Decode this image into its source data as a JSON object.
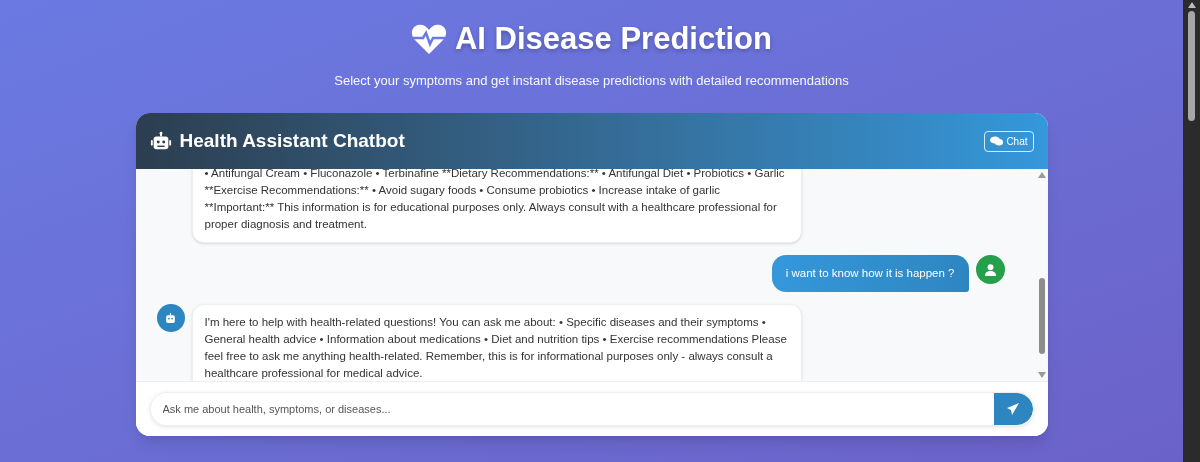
{
  "page": {
    "title": "AI Disease Prediction",
    "subtitle": "Select your symptoms and get instant disease predictions with detailed recommendations"
  },
  "chat": {
    "title": "Health Assistant Chatbot",
    "header_button": "Chat",
    "messages": [
      {
        "kind": "bot",
        "avatar": false,
        "text": "• Antifungal Cream • Fluconazole • Terbinafine **Dietary Recommendations:** • Antifungal Diet • Probiotics • Garlic **Exercise Recommendations:** • Avoid sugary foods • Consume probiotics • Increase intake of garlic **Important:** This information is for educational purposes only. Always consult with a healthcare professional for proper diagnosis and treatment."
      },
      {
        "kind": "user",
        "avatar": true,
        "text": "i want to know how it is happen ?"
      },
      {
        "kind": "bot",
        "avatar": true,
        "text": "I'm here to help with health-related questions! You can ask me about: • Specific diseases and their symptoms • General health advice • Information about medications • Diet and nutrition tips • Exercise recommendations Please feel free to ask me anything health-related. Remember, this is for informational purposes only - always consult a healthcare professional for medical advice."
      }
    ],
    "input": {
      "placeholder": "Ask me about health, symptoms, or diseases..."
    }
  }
}
